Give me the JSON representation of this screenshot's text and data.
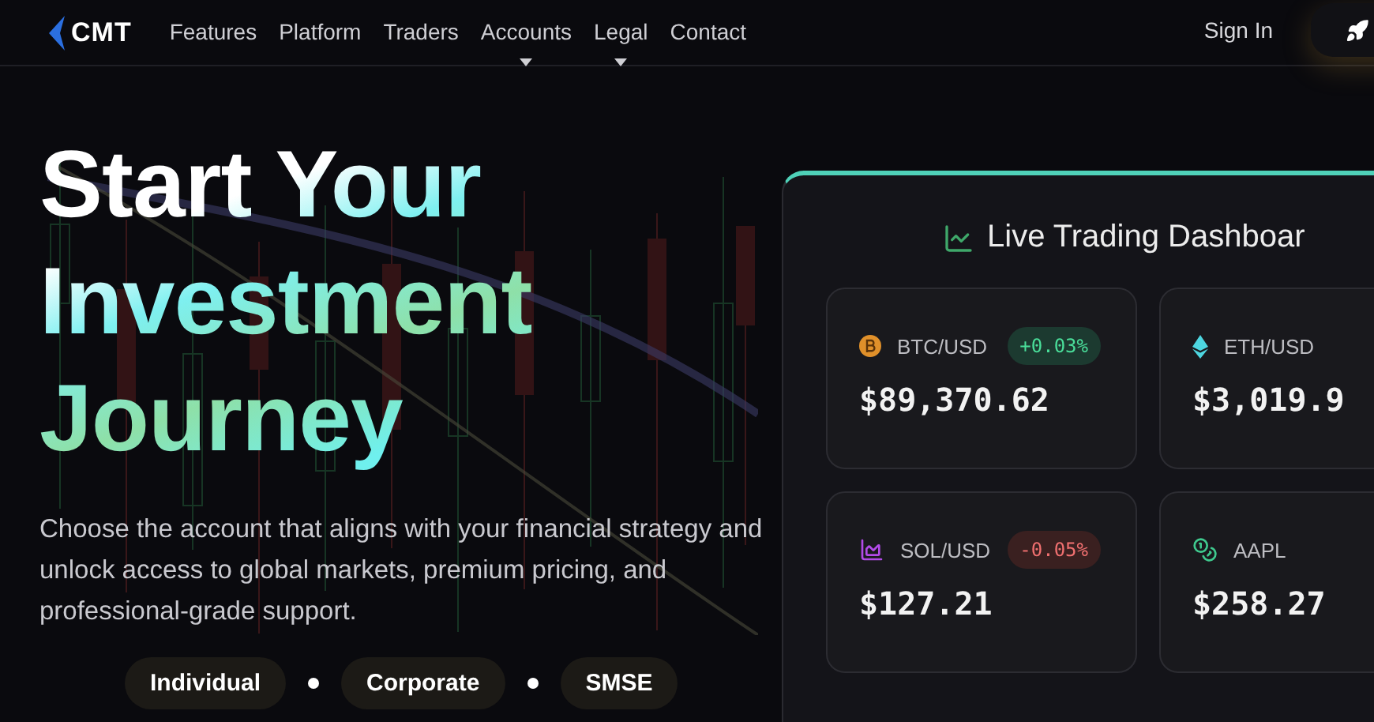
{
  "nav": {
    "logo": "CMT",
    "items": [
      {
        "label": "Features",
        "has_menu": false
      },
      {
        "label": "Platform",
        "has_menu": false
      },
      {
        "label": "Traders",
        "has_menu": false
      },
      {
        "label": "Accounts",
        "has_menu": true
      },
      {
        "label": "Legal",
        "has_menu": true
      },
      {
        "label": "Contact",
        "has_menu": false
      }
    ],
    "sign_in": "Sign In"
  },
  "hero": {
    "title": "Start Your Investment Journey",
    "text": "Choose the account that aligns with your financial strategy and unlock access to global markets, premium pricing, and professional-grade support.",
    "account_types": [
      "Individual",
      "Corporate",
      "SMSE"
    ]
  },
  "dashboard": {
    "title": "Live Trading Dashboar",
    "tickers": [
      {
        "symbol": "BTC/USD",
        "price": "$89,370.62",
        "change": "+0.03%",
        "positive": true
      },
      {
        "symbol": "ETH/USD",
        "price": "$3,019.9"
      },
      {
        "symbol": "SOL/USD",
        "price": "$127.21",
        "change": "-0.05%",
        "positive": false
      },
      {
        "symbol": "AAPL",
        "price": "$258.27"
      }
    ]
  }
}
